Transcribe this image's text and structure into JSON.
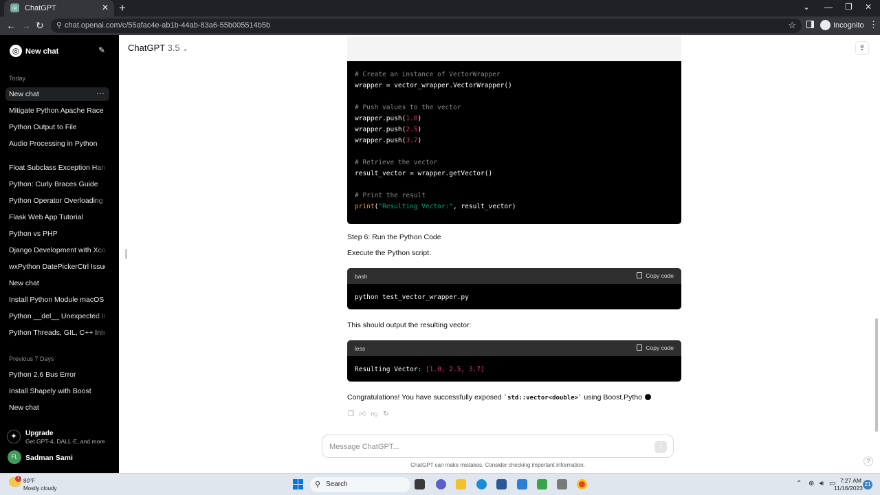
{
  "browser": {
    "tab_title": "ChatGPT",
    "tab_favicon": "openai-logo",
    "new_tab_label": "+",
    "url": "chat.openai.com/c/55afac4e-ab1b-44ab-83a6-55b005514b5b",
    "incognito_label": "Incognito"
  },
  "sidebar": {
    "new_chat_label": "New chat",
    "sections": [
      {
        "title": "Today",
        "items": [
          {
            "label": "New chat",
            "active": true
          },
          {
            "label": "Mitigate Python Apache Race"
          },
          {
            "label": "Python Output to File"
          },
          {
            "label": "Audio Processing in Python"
          },
          {
            "label": "Float Subclass Exception Handling"
          },
          {
            "label": "Python: Curly Braces Guide"
          },
          {
            "label": "Python Operator Overloading Tutorial"
          },
          {
            "label": "Flask Web App Tutorial"
          },
          {
            "label": "Python vs PHP"
          },
          {
            "label": "Django Development with Xcode"
          },
          {
            "label": "wxPython DatePickerCtrl Issue"
          },
          {
            "label": "New chat"
          },
          {
            "label": "Install Python Module macOS"
          },
          {
            "label": "Python __del__ Unexpected Invocation"
          },
          {
            "label": "Python Threads, GIL, C++ Integration"
          }
        ]
      },
      {
        "title": "Previous 7 Days",
        "items": [
          {
            "label": "Python 2.6 Bus Error"
          },
          {
            "label": "Install Shapely with Boost"
          },
          {
            "label": "New chat"
          }
        ]
      }
    ],
    "upgrade": {
      "title": "Upgrade",
      "subtitle": "Get GPT-4, DALL·E, and more"
    },
    "user": {
      "initials": "FL",
      "name": "Sadman Sami"
    }
  },
  "main": {
    "model_name": "ChatGPT",
    "model_version": "3.5",
    "code_block_1": {
      "lines": [
        {
          "t": "comment",
          "text": "# Create an instance of VectorWrapper"
        },
        {
          "t": "plain",
          "text": "wrapper = vector_wrapper.VectorWrapper()"
        },
        {
          "t": "blank",
          "text": ""
        },
        {
          "t": "comment",
          "text": "# Push values to the vector"
        },
        {
          "t": "push",
          "text": "wrapper.push(",
          "num": "1.0"
        },
        {
          "t": "push",
          "text": "wrapper.push(",
          "num": "2.5"
        },
        {
          "t": "push",
          "text": "wrapper.push(",
          "num": "3.7"
        },
        {
          "t": "blank",
          "text": ""
        },
        {
          "t": "comment",
          "text": "# Retrieve the vector"
        },
        {
          "t": "plain",
          "text": "result_vector = wrapper.getVector()"
        },
        {
          "t": "blank",
          "text": ""
        },
        {
          "t": "comment",
          "text": "# Print the result"
        },
        {
          "t": "print",
          "fn": "print",
          "str": "\"Resulting Vector:\"",
          "rest": ", result_vector)"
        }
      ]
    },
    "step6_heading": "Step 6: Run the Python Code",
    "step6_text": "Execute the Python script:",
    "code_block_2": {
      "lang": "bash",
      "copy_label": "Copy code",
      "code": "python test_vector_wrapper.py"
    },
    "output_intro": "This should output the resulting vector:",
    "code_block_3": {
      "lang": "less",
      "copy_label": "Copy code",
      "code_prefix": "Resulting Vector: ",
      "code_values": "[1.0, 2.5, 3.7]"
    },
    "final_text_prefix": "Congratulations! You have successfully exposed ",
    "final_code": "`std::vector<double>`",
    "final_text_suffix": " using Boost.Pytho",
    "composer_placeholder": "Message ChatGPT...",
    "disclaimer": "ChatGPT can make mistakes. Consider checking important information."
  },
  "taskbar": {
    "weather_temp": "80°F",
    "weather_desc": "Mostly cloudy",
    "weather_badge": "1",
    "search_label": "Search",
    "time": "7:27 AM",
    "date": "11/16/2023",
    "notification_count": "21"
  }
}
